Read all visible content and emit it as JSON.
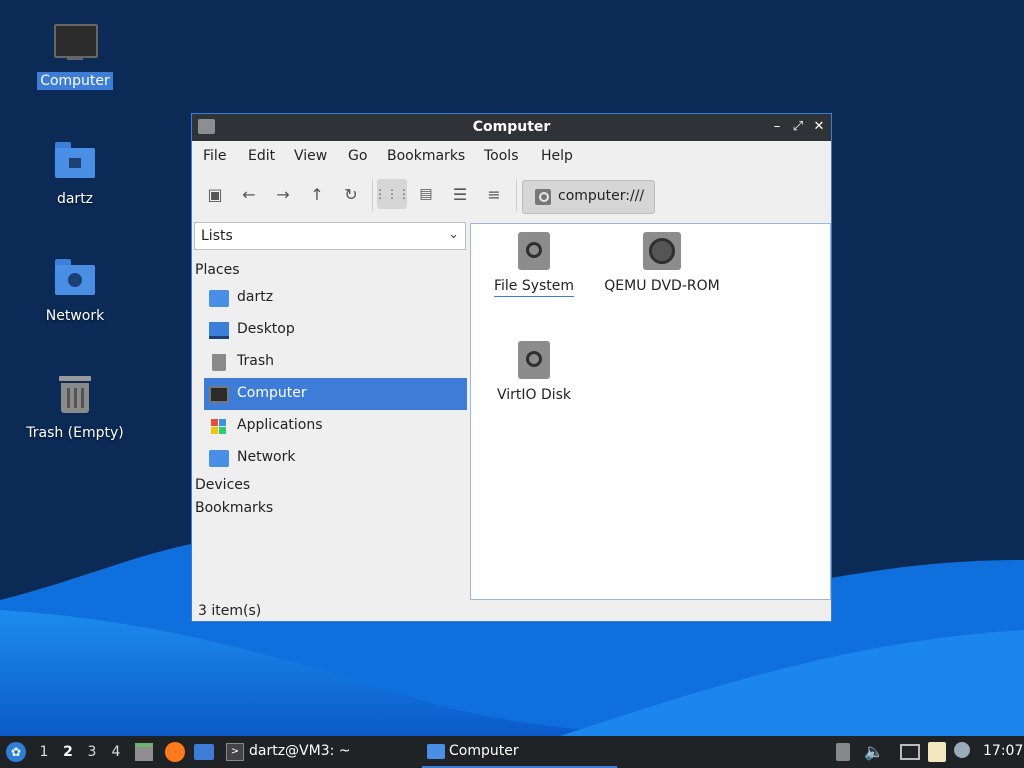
{
  "desktop": {
    "icons": [
      {
        "label": "Computer"
      },
      {
        "label": "dartz"
      },
      {
        "label": "Network"
      },
      {
        "label": "Trash (Empty)"
      }
    ]
  },
  "window": {
    "title": "Computer",
    "menu": [
      "File",
      "Edit",
      "View",
      "Go",
      "Bookmarks",
      "Tools",
      "Help"
    ],
    "path": "computer:///",
    "side": {
      "view_selector": "Lists",
      "places_header": "Places",
      "places": [
        {
          "label": "dartz",
          "icon": "home-folder-icon"
        },
        {
          "label": "Desktop",
          "icon": "desktop-icon"
        },
        {
          "label": "Trash",
          "icon": "trash-icon"
        },
        {
          "label": "Computer",
          "icon": "computer-icon"
        },
        {
          "label": "Applications",
          "icon": "applications-icon"
        },
        {
          "label": "Network",
          "icon": "network-folder-icon"
        }
      ],
      "devices_header": "Devices",
      "bookmarks_header": "Bookmarks"
    },
    "items": [
      {
        "label": "File System",
        "icon": "drive-icon"
      },
      {
        "label": "QEMU DVD-ROM",
        "icon": "optical-drive-icon"
      },
      {
        "label": "VirtIO Disk",
        "icon": "drive-icon"
      }
    ],
    "status": "3 item(s)"
  },
  "taskbar": {
    "workspaces": [
      "1",
      "2",
      "3",
      "4"
    ],
    "active_workspace": "2",
    "tasks": [
      {
        "label": "dartz@VM3: ~"
      },
      {
        "label": "Computer"
      }
    ],
    "clock": "17:07"
  },
  "colors": {
    "accent": "#3d7dd8",
    "titlebar": "#2f3338",
    "taskbar": "#1f2326"
  }
}
